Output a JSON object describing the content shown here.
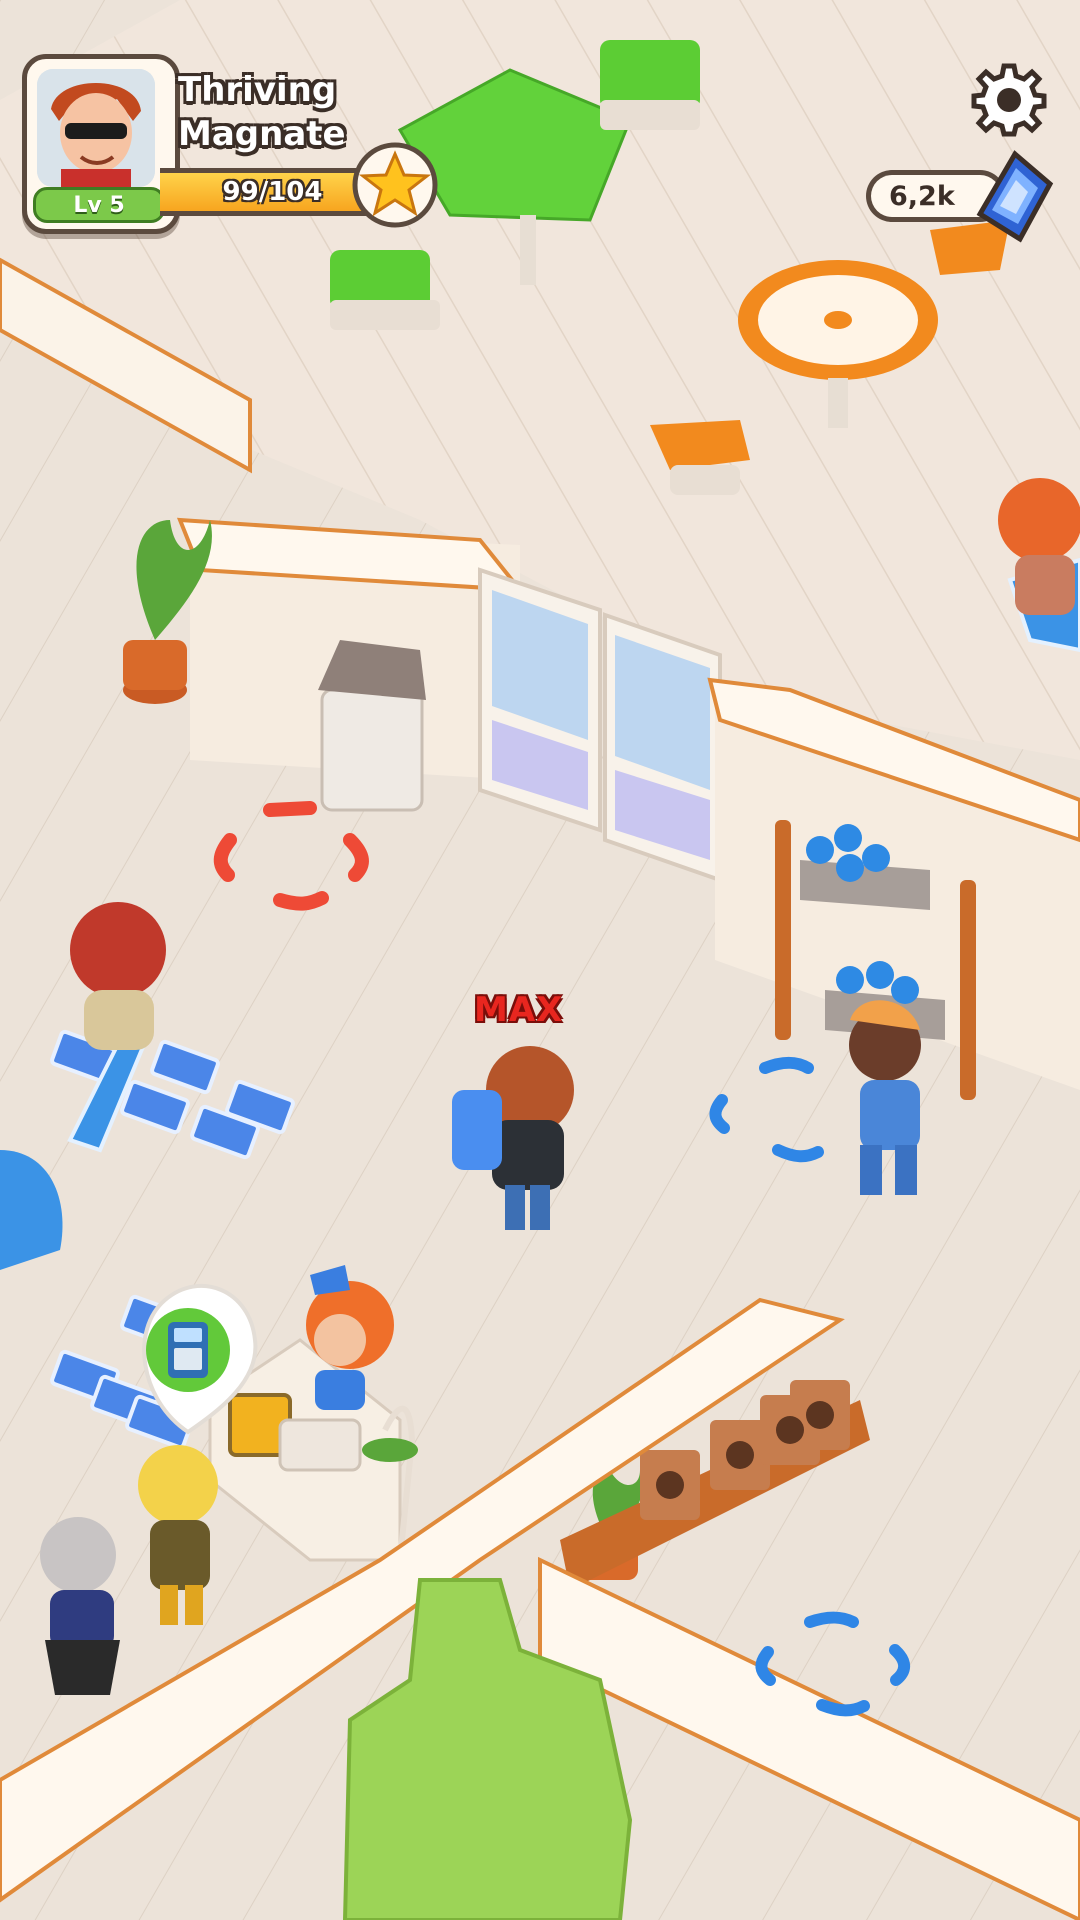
{
  "player": {
    "title": "Thriving Magnate",
    "level_label": "Lv 5",
    "xp_current": 99,
    "xp_max": 104,
    "xp_text": "99/104"
  },
  "currency": {
    "amount_text": "6,2k",
    "icon": "gem-stack-icon"
  },
  "settings": {
    "icon": "gear-icon"
  },
  "scene": {
    "player_tag": "MAX",
    "checkout_marker_icon": "card-terminal-icon"
  },
  "colors": {
    "accent_orange": "#f28a1e",
    "xp_fill": "#f7a51f",
    "level_green": "#7cc94a",
    "outline": "#5b4a3e",
    "max_tag_red": "#e8261f",
    "zone_red": "#ee4a36",
    "zone_blue": "#2f86e6"
  }
}
